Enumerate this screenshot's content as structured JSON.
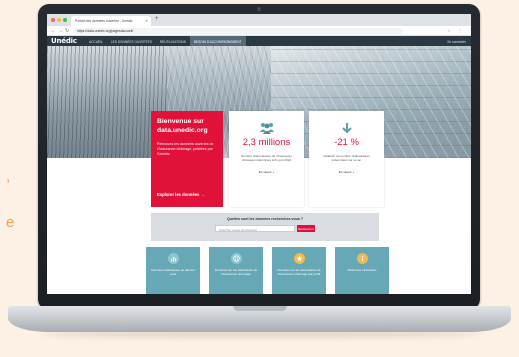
{
  "background": {
    "fragments": [
      ",",
      "e"
    ]
  },
  "browser": {
    "tab_title": "Portail des données ouvertes - Unédic",
    "url": "https://data.unedic.org/pages/accueil/"
  },
  "site": {
    "logo": "Unédic",
    "menu": [
      {
        "label": "Accueil",
        "active": false
      },
      {
        "label": "Les données ouvertes",
        "active": false
      },
      {
        "label": "Réutilisations",
        "active": false
      },
      {
        "label": "Besoin d'accompagnement",
        "active": true
      }
    ],
    "signin": "Se connecter"
  },
  "welcome": {
    "title": "Bienvenue sur data.unedic.org",
    "text": "Retrouvez les données ouvertes de l'Assurance chômage, publiées par l'Unédic",
    "cta": "Explorer les données →"
  },
  "stats": [
    {
      "icon": "people-icon",
      "value": "2,3 millions",
      "description": "Nombre d'allocataires de l'Assurance chômage indemnisés à fin juin 2024",
      "link": "En savoir +"
    },
    {
      "icon": "arrow-down-icon",
      "value": "-21 %",
      "description": "Variation du nombre d'allocataires indemnisés sur un an",
      "link": "En savoir +"
    }
  ],
  "search": {
    "title": "Quelles sont les données recherchez-vous ?",
    "placeholder": "Chercher un jeu de données",
    "button": "Rechercher"
  },
  "tiles": [
    {
      "icon": "chart-icon",
      "label": "Données statistiques au dernier mois"
    },
    {
      "icon": "globe-icon",
      "label": "Données sur les indicateurs de l'Assurance chômage"
    },
    {
      "icon": "star-icon",
      "label": "Données sur les allocataires de l'Assurance chômage par profil"
    },
    {
      "icon": "info-icon",
      "label": "Réformes / Evolution"
    }
  ],
  "colors": {
    "accent": "#e2113a",
    "header": "#2a3943",
    "tile": "#67a8b6",
    "tile_icon": "#f0b948"
  }
}
